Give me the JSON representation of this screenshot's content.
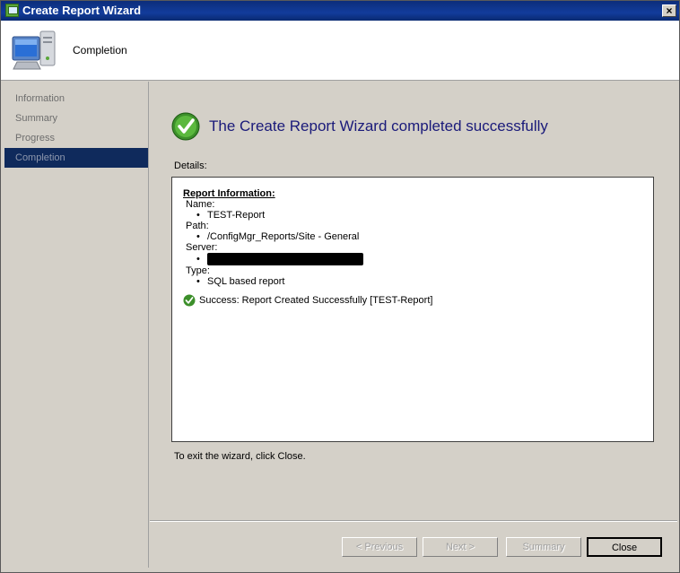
{
  "window": {
    "title": "Create Report Wizard",
    "close_glyph": "×"
  },
  "header": {
    "title": "Completion",
    "icon": "computer-icon"
  },
  "nav": {
    "items": [
      {
        "label": "Information"
      },
      {
        "label": "Summary"
      },
      {
        "label": "Progress"
      },
      {
        "label": "Completion"
      }
    ],
    "selected": "Completion"
  },
  "content": {
    "headline": "The Create Report Wizard completed successfully",
    "details_label": "Details:",
    "details": {
      "section_title": "Report Information:",
      "name_label": "Name:",
      "name_value": "TEST-Report",
      "path_label": "Path:",
      "path_value": "/ConfigMgr_Reports/Site - General",
      "server_label": "Server:",
      "type_label": "Type:",
      "type_value": "SQL based report",
      "success_message": "Success: Report Created Successfully [TEST-Report]"
    },
    "exit_text": "To exit the wizard, click Close."
  },
  "buttons": {
    "previous": "< Previous",
    "next": "Next >",
    "summary": "Summary",
    "close": "Close"
  },
  "colors": {
    "headline": "#1a1a7a",
    "nav_selected": "#0f2a5c",
    "titlebar": "#123c9c"
  }
}
